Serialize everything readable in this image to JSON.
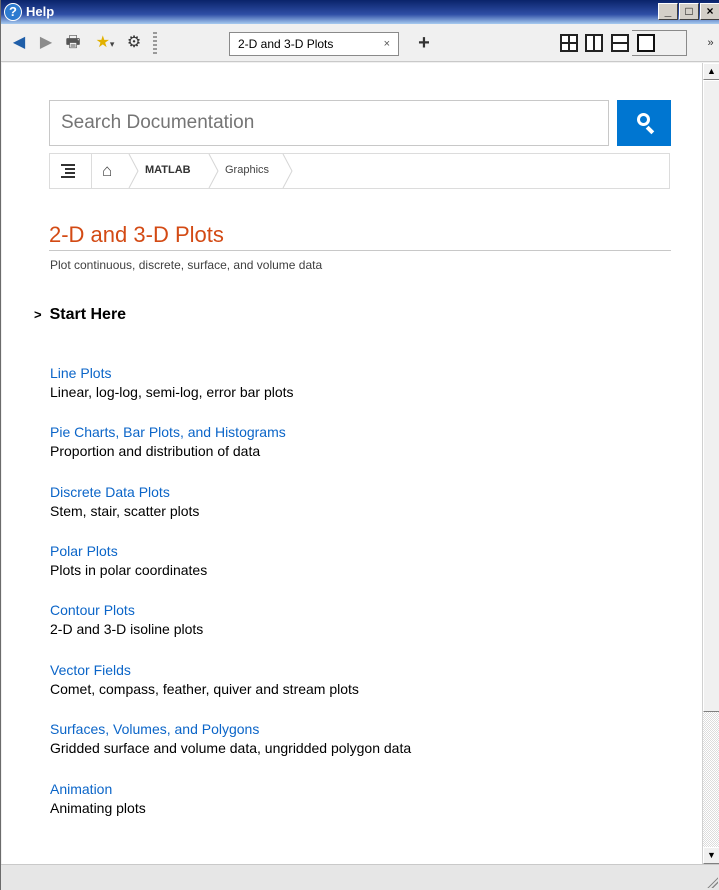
{
  "window": {
    "title": "Help",
    "btn_minimize": "_",
    "btn_maximize": "□",
    "btn_close": "×"
  },
  "toolbar": {
    "tab_label": "2-D and 3-D Plots",
    "tab_close": "×",
    "new_tab": "+"
  },
  "search": {
    "placeholder": "Search Documentation"
  },
  "breadcrumb": {
    "items": [
      "MATLAB",
      "Graphics"
    ]
  },
  "page": {
    "title": "2-D and 3-D Plots",
    "subtitle": "Plot continuous, discrete, surface, and volume data",
    "start_here": "Start Here",
    "topics": [
      {
        "link": "Line Plots",
        "desc": "Linear, log-log, semi-log, error bar plots"
      },
      {
        "link": "Pie Charts, Bar Plots, and Histograms",
        "desc": "Proportion and distribution of data"
      },
      {
        "link": "Discrete Data Plots",
        "desc": "Stem, stair, scatter plots"
      },
      {
        "link": "Polar Plots",
        "desc": "Plots in polar coordinates"
      },
      {
        "link": "Contour Plots",
        "desc": "2-D and 3-D isoline plots"
      },
      {
        "link": "Vector Fields",
        "desc": "Comet, compass, feather, quiver and stream plots"
      },
      {
        "link": "Surfaces, Volumes, and Polygons",
        "desc": "Gridded surface and volume data, ungridded polygon data"
      },
      {
        "link": "Animation",
        "desc": "Animating plots"
      }
    ]
  },
  "colors": {
    "accent": "#0076d1",
    "title": "#d34a14",
    "link": "#0b65c8"
  }
}
